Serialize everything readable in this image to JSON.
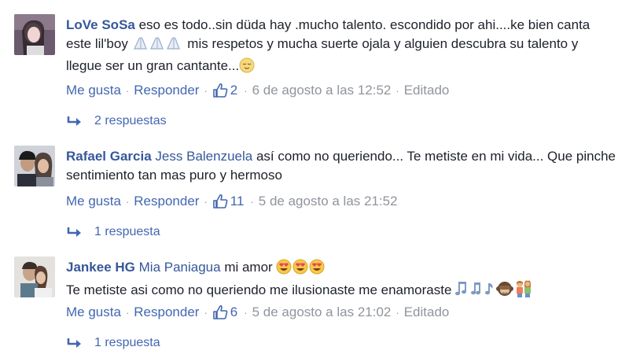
{
  "comments": [
    {
      "author": "LoVe SoSa",
      "text_1": " eso es todo..sin düda hay .mucho talento. escondido por ahi....ke bien canta este lil'boy ",
      "text_2": " mis respetos y mucha suerte ojala y alguien descubra su talento y llegue ser un gran cantante...",
      "like": "Me gusta",
      "reply": "Responder",
      "likes": "2",
      "time": "6 de agosto a las 12:52",
      "edited": "Editado",
      "replies": "2 respuestas"
    },
    {
      "author": "Rafael Garcia",
      "mention": "Jess Balenzuela",
      "text": " así como no queriendo... Te metiste en mi vida... Que pinche sentimiento tan mas puro y hermoso",
      "like": "Me gusta",
      "reply": "Responder",
      "likes": "11",
      "time": "5 de agosto a las 21:52",
      "replies": "1 respuesta"
    },
    {
      "author": "Jankee HG",
      "mention": "Mia Paniagua",
      "text_1": " mi amor ",
      "text_2": "Te metiste asi como no queriendo me ilusionaste me enamoraste ",
      "like": "Me gusta",
      "reply": "Responder",
      "likes": "6",
      "time": "5 de agosto a las 21:02",
      "edited": "Editado",
      "replies": "1 respuesta"
    }
  ],
  "colors": {
    "link": "#4267b2",
    "author": "#365899",
    "meta": "#90949c",
    "text": "#1d2129"
  },
  "icons": [
    "thumbs-up-icon",
    "reply-arrow-icon",
    "praying-hands-emoji",
    "relieved-face-emoji",
    "heart-eyes-emoji",
    "music-notes-emoji",
    "see-no-evil-monkey-emoji",
    "couple-emoji"
  ]
}
